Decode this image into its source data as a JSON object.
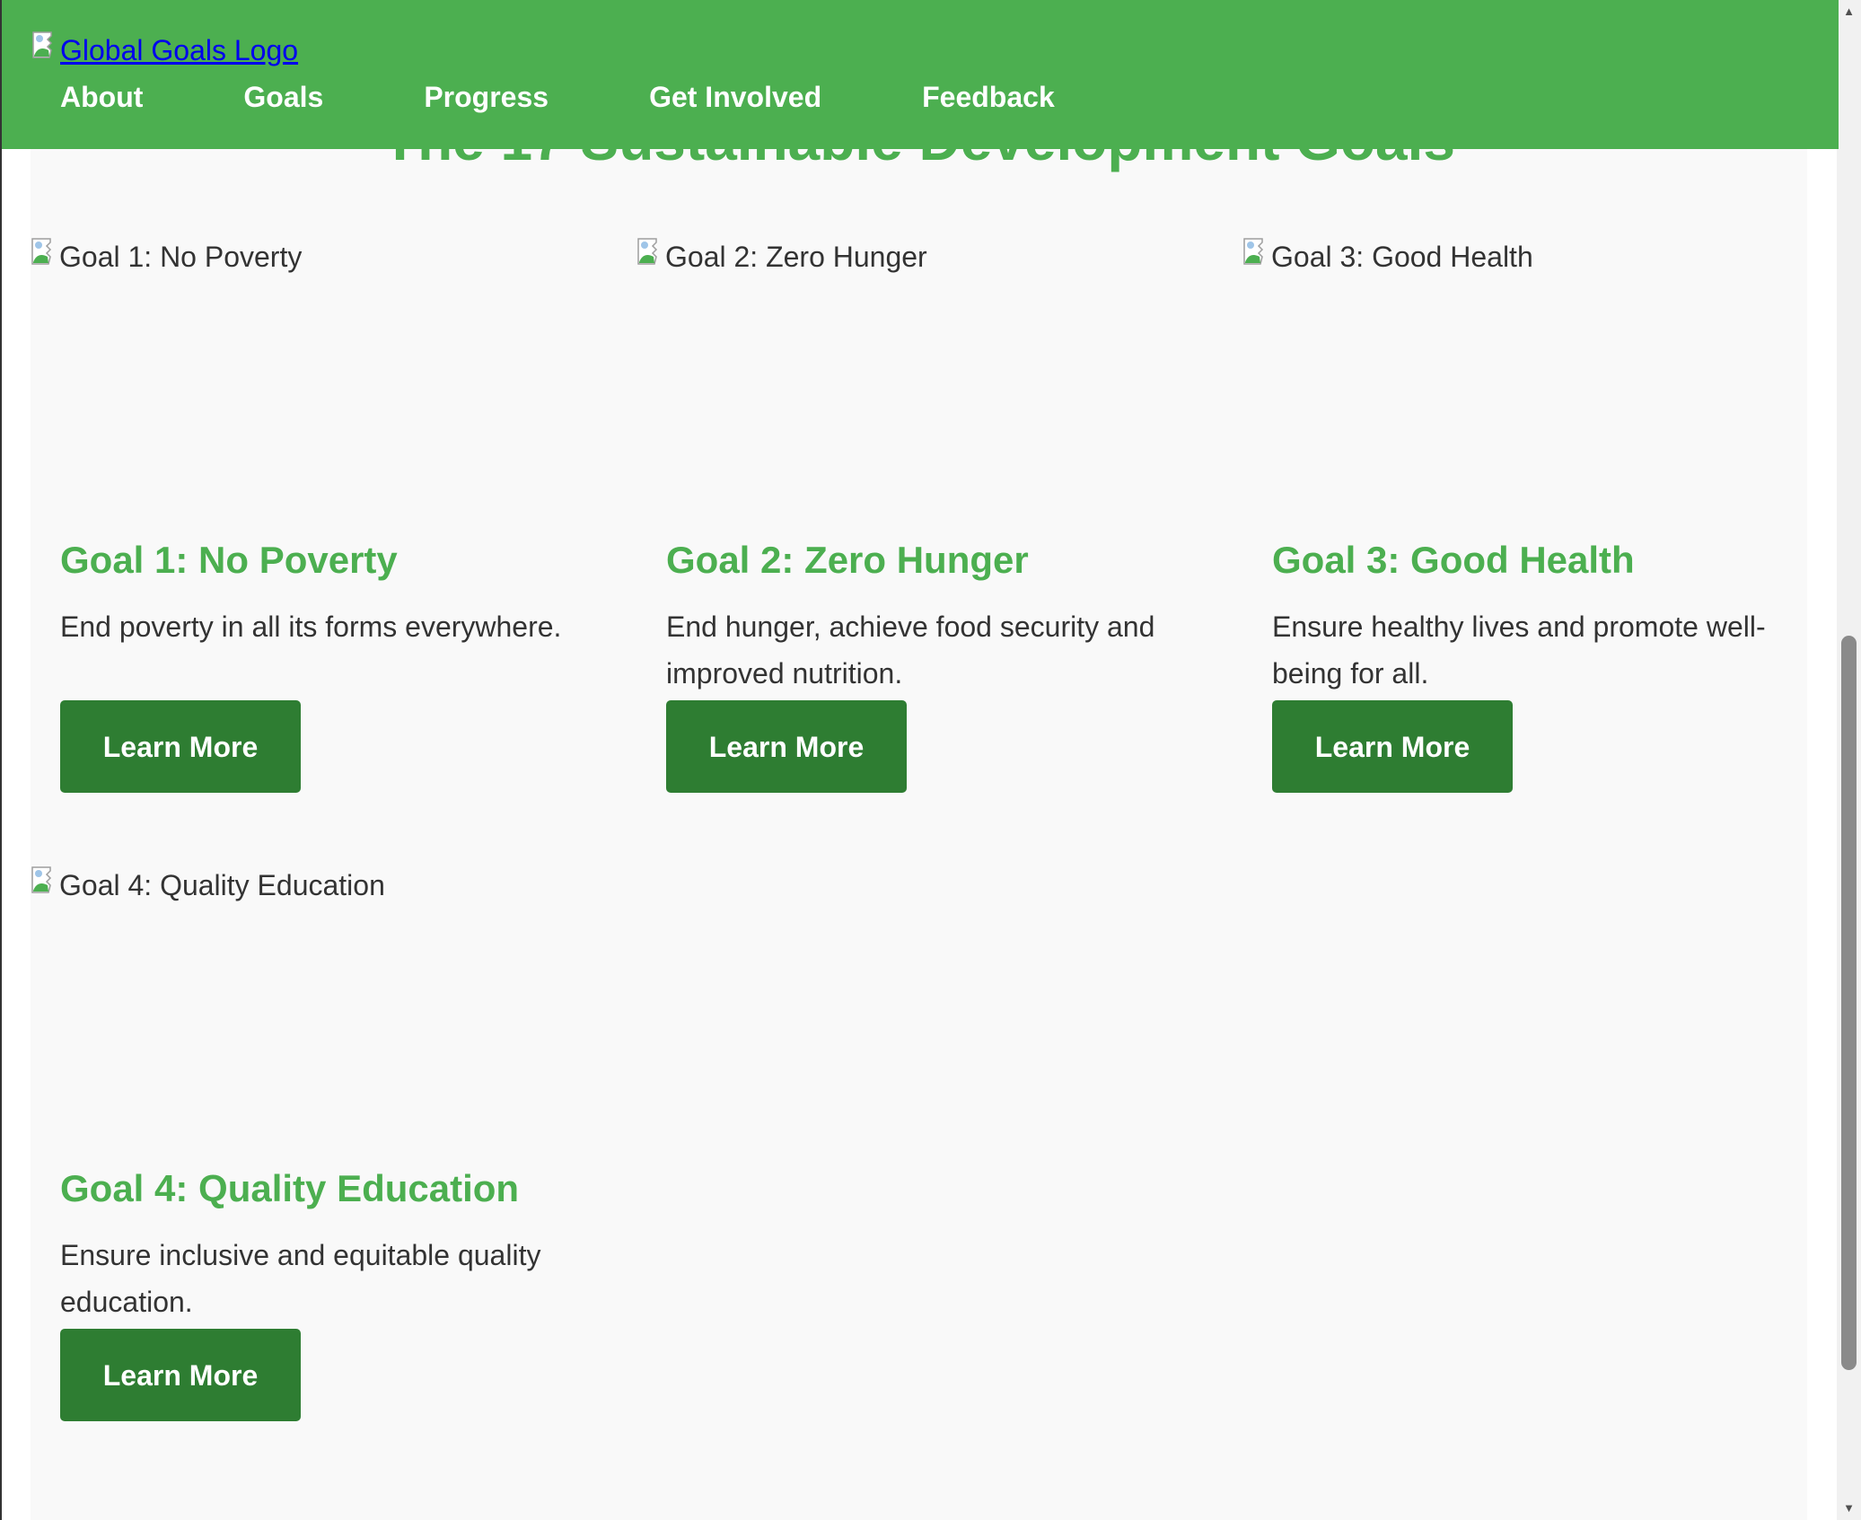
{
  "header": {
    "logo_alt": "Global Goals Logo",
    "nav": [
      {
        "label": "About"
      },
      {
        "label": "Goals"
      },
      {
        "label": "Progress"
      },
      {
        "label": "Get Involved"
      },
      {
        "label": "Feedback"
      }
    ]
  },
  "main": {
    "section_title": "The 17 Sustainable Development Goals",
    "goals": [
      {
        "image_alt": "Goal 1: No Poverty",
        "title": "Goal 1: No Poverty",
        "description": "End poverty in all its forms everywhere.",
        "button_label": "Learn More"
      },
      {
        "image_alt": "Goal 2: Zero Hunger",
        "title": "Goal 2: Zero Hunger",
        "description": "End hunger, achieve food security and improved nutrition.",
        "button_label": "Learn More"
      },
      {
        "image_alt": "Goal 3: Good Health",
        "title": "Goal 3: Good Health",
        "description": "Ensure healthy lives and promote well-being for all.",
        "button_label": "Learn More"
      },
      {
        "image_alt": "Goal 4: Quality Education",
        "title": "Goal 4: Quality Education",
        "description": "Ensure inclusive and equitable quality education.",
        "button_label": "Learn More"
      }
    ]
  },
  "colors": {
    "header_bg": "#4caf50",
    "heading": "#4caf50",
    "button_bg": "#2e7d32",
    "button_text": "#ffffff",
    "body_text": "#333333",
    "link": "#0000ee"
  },
  "icons": {
    "broken_image": "broken-image-icon",
    "scroll_up": "scroll-up-arrow-icon",
    "scroll_down": "scroll-down-arrow-icon"
  }
}
